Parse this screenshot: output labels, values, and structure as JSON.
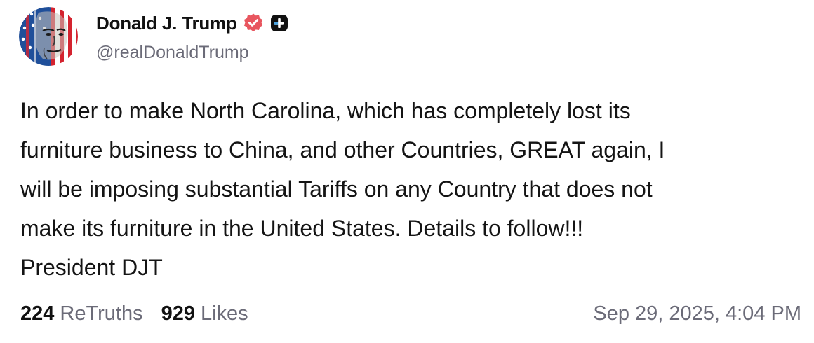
{
  "author": {
    "display_name": "Donald J. Trump",
    "handle": "@realDonaldTrump",
    "verified_badge_color": "#e8565f",
    "plus_badge_color": "#111111"
  },
  "post": {
    "text": "In order to make North Carolina, which has completely lost its\nfurniture business to China, and other Countries, GREAT again, I\nwill be imposing substantial Tariffs on any Country that does not\nmake its furniture in the United States. Details to follow!!!\nPresident DJT"
  },
  "stats": {
    "retruths_count": "224",
    "retruths_label": "ReTruths",
    "likes_count": "929",
    "likes_label": "Likes"
  },
  "timestamp": "Sep 29, 2025, 4:04 PM",
  "colors": {
    "text": "#141414",
    "muted": "#6b6b78",
    "background": "#ffffff"
  },
  "icons": {
    "verified": "verified-badge-icon",
    "plus": "plus-badge-icon"
  }
}
